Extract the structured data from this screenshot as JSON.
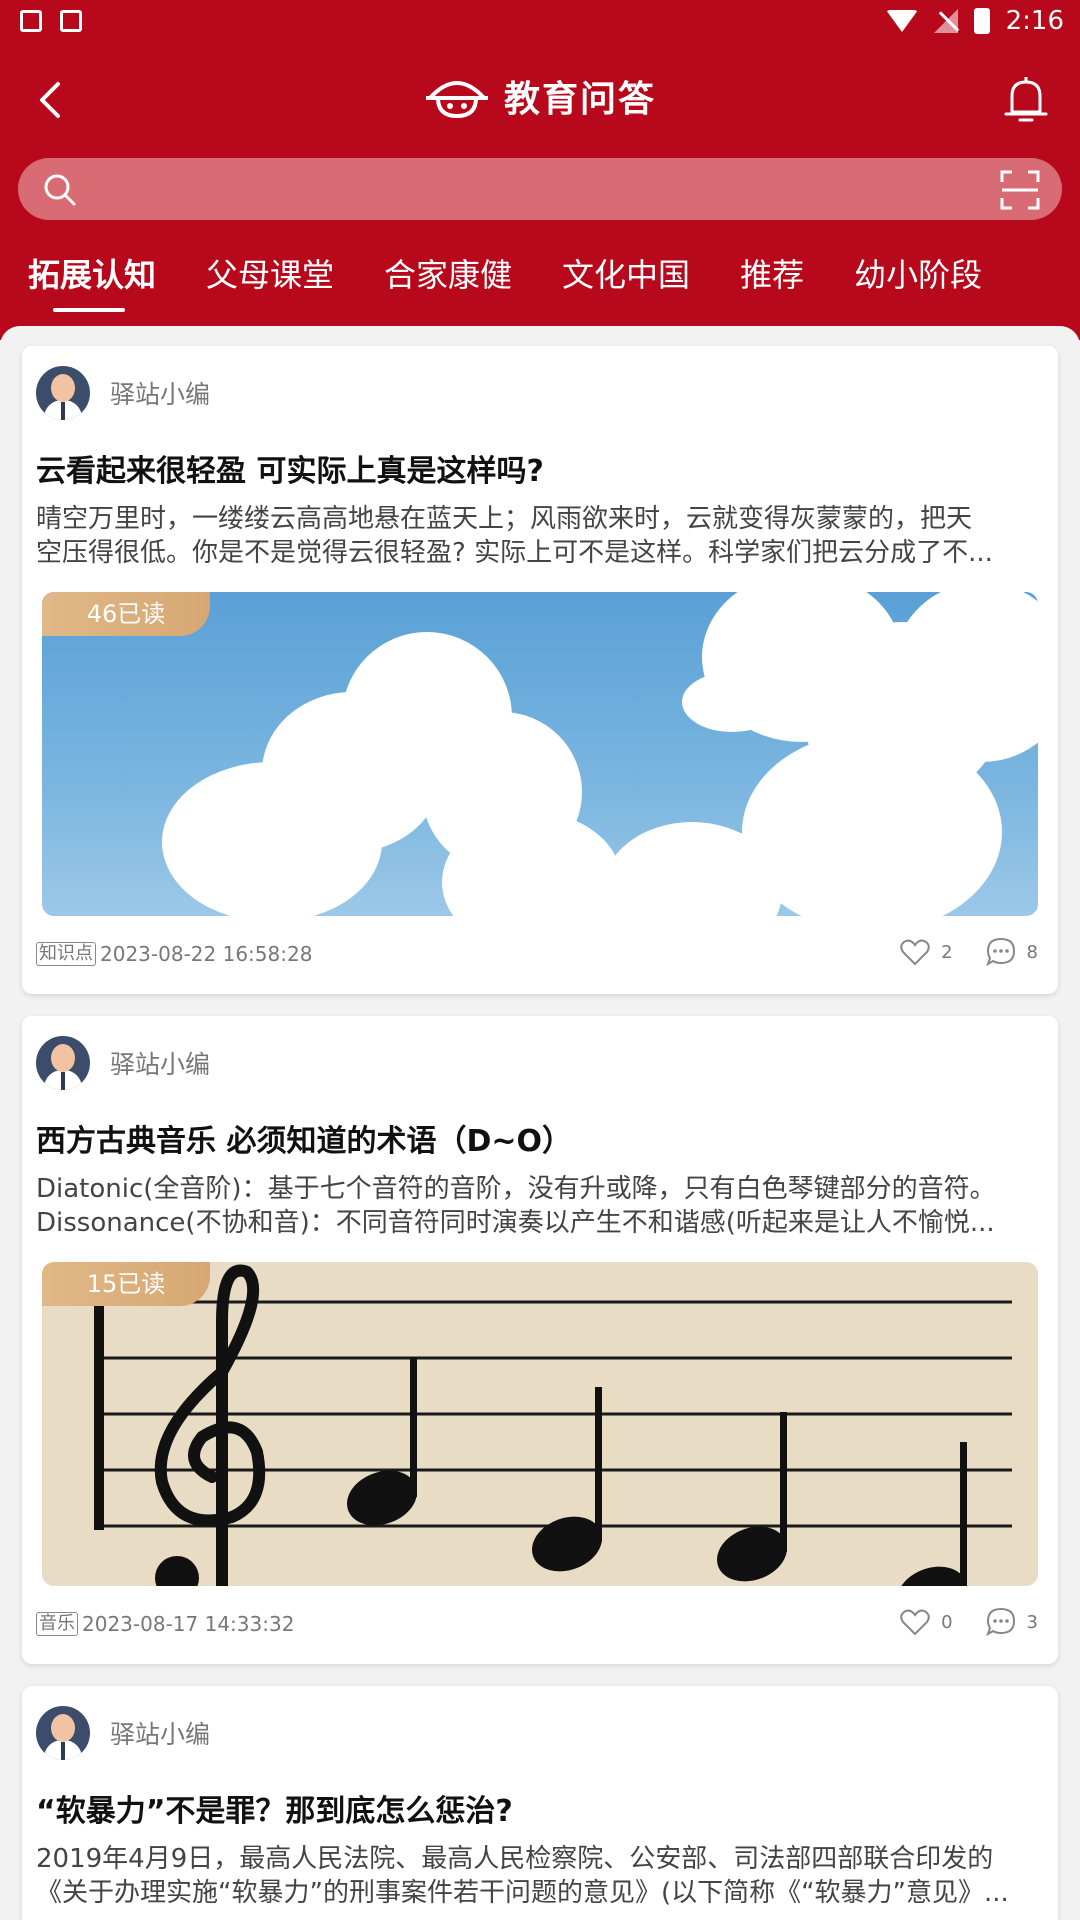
{
  "status_bar": {
    "time": "2:16"
  },
  "header": {
    "title": "教育问答"
  },
  "search": {
    "placeholder": ""
  },
  "tabs": [
    {
      "label": "拓展认知",
      "active": true
    },
    {
      "label": "父母课堂",
      "active": false
    },
    {
      "label": "合家康健",
      "active": false
    },
    {
      "label": "文化中国",
      "active": false
    },
    {
      "label": "推荐",
      "active": false
    },
    {
      "label": "幼小阶段",
      "active": false
    }
  ],
  "articles": [
    {
      "author": "驿站小编",
      "title": "云看起来很轻盈 可实际上真是这样吗?",
      "summary_line1": "晴空万里时，一缕缕云高高地悬在蓝天上；风雨欲来时，云就变得灰蒙蒙的，把天",
      "summary_line2": "空压得很低。你是不是觉得云很轻盈? 实际上可不是这样。科学家们把云分成了不...",
      "reads": "46已读",
      "tag": "知识点",
      "date": "2023-08-22 16:58:28",
      "likes": "2",
      "comments": "8"
    },
    {
      "author": "驿站小编",
      "title": "西方古典音乐 必须知道的术语（D~O）",
      "summary_line1": "Diatonic(全音阶)：基于七个音符的音阶，没有升或降，只有白色琴键部分的音符。",
      "summary_line2": "Dissonance(不协和音)：不同音符同时演奏以产生不和谐感(听起来是让人不愉悦...",
      "reads": "15已读",
      "tag": "音乐",
      "date": "2023-08-17 14:33:32",
      "likes": "0",
      "comments": "3"
    },
    {
      "author": "驿站小编",
      "title": "“软暴力”不是罪？那到底怎么惩治?",
      "summary_line1": "2019年4月9日，最高人民法院、最高人民检察院、公安部、司法部四部联合印发的",
      "summary_line2": "《关于办理实施“软暴力”的刑事案件若干问题的意见》(以下简称《“软暴力”意见》..."
    }
  ],
  "colors": {
    "brand": "#b8091c",
    "badge": "#d9ab76"
  }
}
